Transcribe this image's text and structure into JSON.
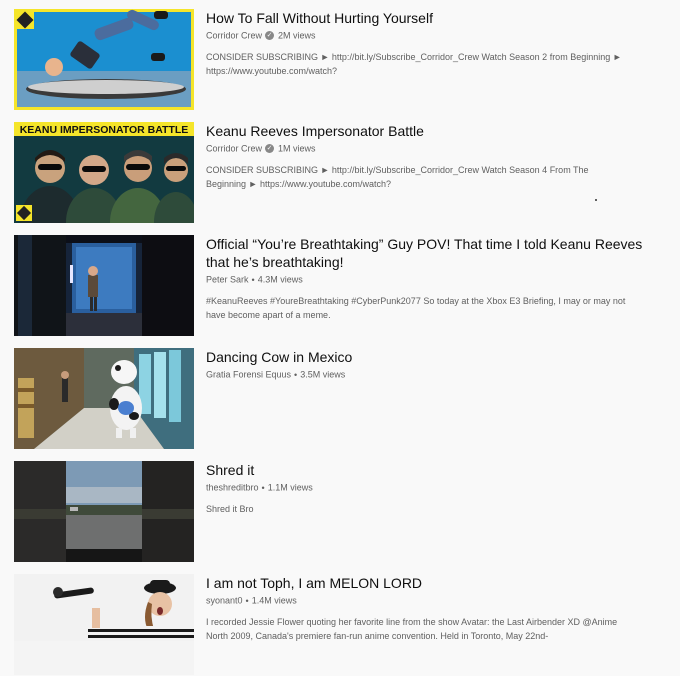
{
  "results": [
    {
      "title": "How To Fall Without Hurting Yourself",
      "channel": "Corridor Crew",
      "verified": true,
      "views": "2M views",
      "description": "CONSIDER SUBSCRIBING ► http://bit.ly/Subscribe_Corridor_Crew Watch Season 2 from Beginning ► https://www.youtube.com/watch?"
    },
    {
      "title": "Keanu Reeves Impersonator Battle",
      "channel": "Corridor Crew",
      "verified": true,
      "views": "1M views",
      "description": "CONSIDER SUBSCRIBING ► http://bit.ly/Subscribe_Corridor_Crew Watch Season 4 From The Beginning ► https://www.youtube.com/watch?",
      "thumb_text": "KEANU IMPERSONATOR BATTLE"
    },
    {
      "title": "Official “You’re Breathtaking” Guy POV! That time I told Keanu Reeves that he’s breathtaking!",
      "channel": "Peter Sark",
      "verified": false,
      "views": "4.3M views",
      "description": "#KeanuReeves #YoureBreathtaking #CyberPunk2077 So today at the Xbox E3 Briefing, I may or may not have become apart of a meme."
    },
    {
      "title": "Dancing Cow in Mexico",
      "channel": "Gratia Forensi Equus",
      "verified": false,
      "views": "3.5M views",
      "description": ""
    },
    {
      "title": "Shred it",
      "channel": "theshreditbro",
      "verified": false,
      "views": "1.1M views",
      "description": "Shred it Bro"
    },
    {
      "title": "I am not Toph, I am MELON LORD",
      "channel": "syonant0",
      "verified": false,
      "views": "1.4M views",
      "description": "I recorded Jessie Flower quoting her favorite line from the show Avatar: the Last Airbender XD @Anime North 2009, Canada's premiere fan-run anime convention. Held in Toronto, May 22nd-"
    }
  ],
  "colors": {
    "background": "#f9f9f9",
    "title": "#0f0f0f",
    "meta": "#606060",
    "corridor_yellow": "#f5e52a"
  }
}
